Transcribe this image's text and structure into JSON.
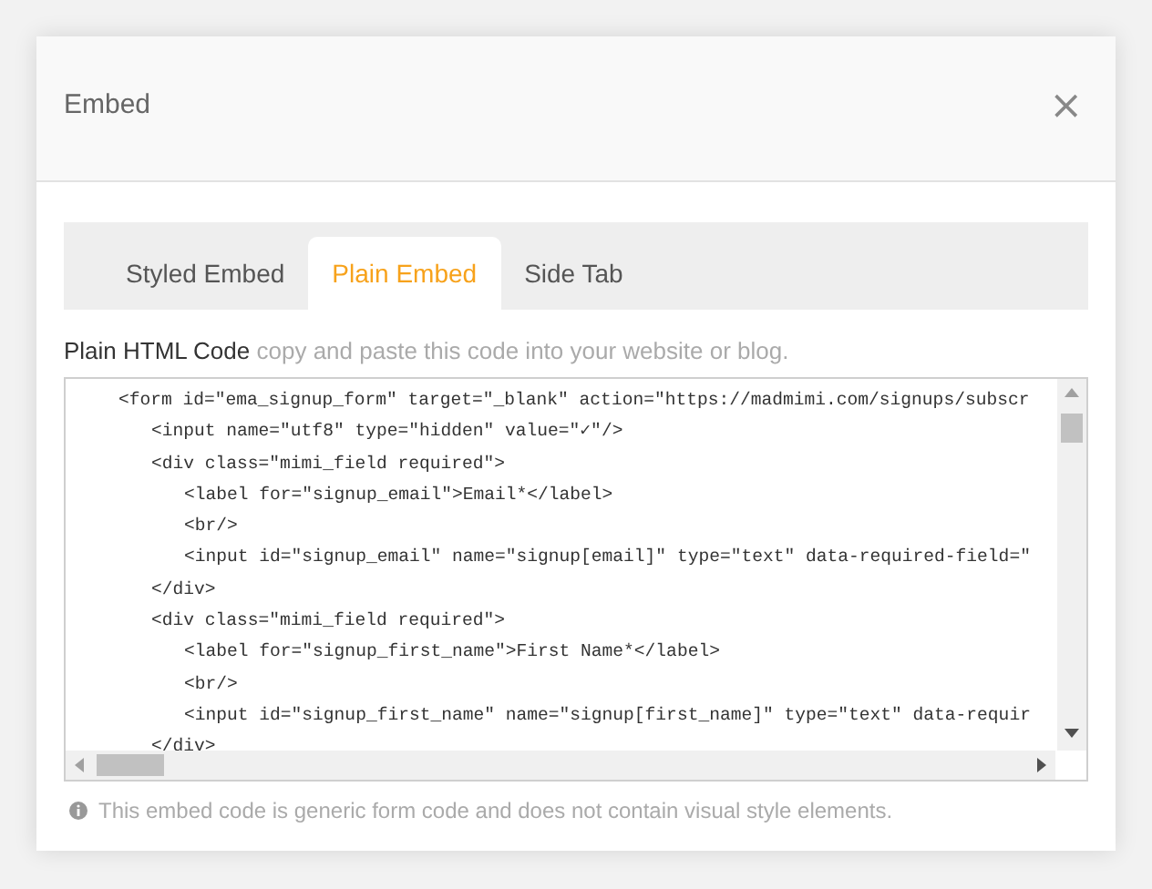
{
  "dialog": {
    "title": "Embed",
    "close": "×"
  },
  "tabs": [
    {
      "label": "Styled Embed",
      "selected": false
    },
    {
      "label": "Plain Embed",
      "selected": true
    },
    {
      "label": "Side Tab",
      "selected": false
    }
  ],
  "code_section": {
    "label": "Plain HTML Code",
    "hint": "copy and paste this code into your website or blog.",
    "lines": [
      {
        "text": "<form id=\"ema_signup_form\" target=\"_blank\" action=\"https://madmimi.com/signups/subscr",
        "children": [
          {
            "text": "<input name=\"utf8\" type=\"hidden\" value=\"✓\"/>"
          },
          {
            "text": "<div class=\"mimi_field required\">",
            "children": [
              {
                "text": "<label for=\"signup_email\">Email*</label>"
              },
              {
                "text": "<br/>"
              },
              {
                "text": "<input id=\"signup_email\" name=\"signup[email]\" type=\"text\" data-required-field=\""
              }
            ]
          },
          {
            "text": "</div>"
          },
          {
            "text": "<div class=\"mimi_field required\">",
            "children": [
              {
                "text": "<label for=\"signup_first_name\">First Name*</label>"
              },
              {
                "text": "<br/>"
              },
              {
                "text": "<input id=\"signup_first_name\" name=\"signup[first_name]\" type=\"text\" data-requir"
              }
            ]
          },
          {
            "text": "</div>"
          }
        ]
      }
    ]
  },
  "note": "This embed code is generic form code and does not contain visual style elements."
}
